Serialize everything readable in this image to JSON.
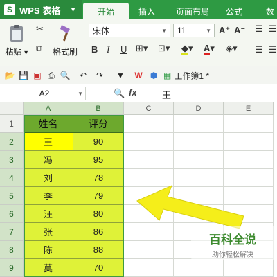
{
  "app": {
    "title": "WPS 表格",
    "logo": "S"
  },
  "tabs": [
    {
      "label": "开始",
      "active": true
    },
    {
      "label": "插入"
    },
    {
      "label": "页面布局"
    },
    {
      "label": "公式"
    },
    {
      "label": "数"
    }
  ],
  "ribbon": {
    "paste_label": "粘贴",
    "format_painter_label": "格式刷",
    "font_name": "宋体",
    "font_size": "11",
    "grow_icon": "A⁺",
    "shrink_icon": "A⁻"
  },
  "quickbar": {
    "doc_title": "工作簿1 *"
  },
  "formula_bar": {
    "cell_ref": "A2",
    "fx_label": "fx",
    "content": "王"
  },
  "grid": {
    "columns": [
      "A",
      "B",
      "C",
      "D",
      "E"
    ],
    "rows": [
      "1",
      "2",
      "3",
      "4",
      "5",
      "6",
      "7",
      "8",
      "9"
    ],
    "header": [
      "姓名",
      "评分"
    ],
    "records": [
      {
        "name": "王",
        "score": "90"
      },
      {
        "name": "冯",
        "score": "95"
      },
      {
        "name": "刘",
        "score": "78"
      },
      {
        "name": "李",
        "score": "79"
      },
      {
        "name": "汪",
        "score": "80"
      },
      {
        "name": "张",
        "score": "86"
      },
      {
        "name": "陈",
        "score": "88"
      },
      {
        "name": "莫",
        "score": "70"
      }
    ]
  },
  "watermark": {
    "title": "百科全说",
    "subtitle": "助你轻松解决"
  },
  "colors": {
    "accent": "#2e9a43",
    "header_fill": "#6da92d",
    "data_fill": "#dff238",
    "active_fill": "#ffff00",
    "arrow": "#f5ee1a"
  }
}
